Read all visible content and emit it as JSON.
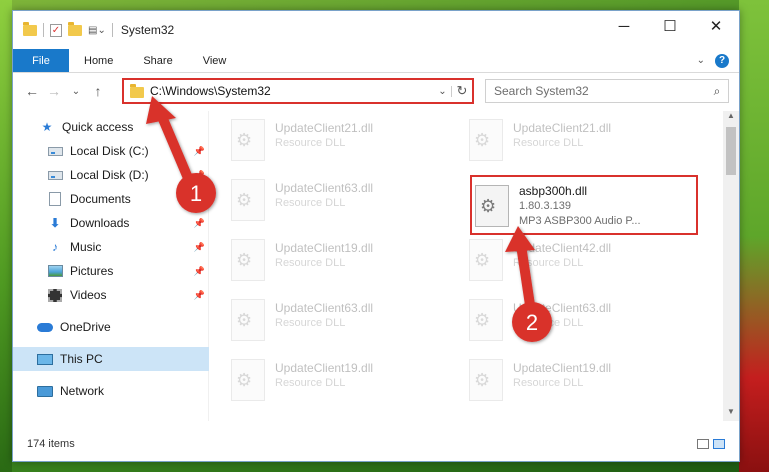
{
  "window": {
    "title": "System32"
  },
  "caption": {
    "minimize": "─",
    "maximize": "☐",
    "close": "✕"
  },
  "ribbon": {
    "tabs": [
      "File",
      "Home",
      "Share",
      "View"
    ],
    "help": "?",
    "expand": "⌄"
  },
  "nav": {
    "back": "←",
    "forward": "→",
    "recent": "⌄",
    "up": "↑"
  },
  "address": {
    "path": "C:\\Windows\\System32",
    "dropdown": "⌄",
    "refresh": "↻"
  },
  "search": {
    "placeholder": "Search System32",
    "icon": "search-icon"
  },
  "sidebar": {
    "items": [
      {
        "label": "Quick access",
        "icon": "star-icon",
        "pinned": false
      },
      {
        "label": "Local Disk (C:)",
        "icon": "drive-icon",
        "pinned": true
      },
      {
        "label": "Local Disk (D:)",
        "icon": "drive-icon",
        "pinned": true
      },
      {
        "label": "Documents",
        "icon": "documents-icon",
        "pinned": true
      },
      {
        "label": "Downloads",
        "icon": "download-icon",
        "pinned": true
      },
      {
        "label": "Music",
        "icon": "music-icon",
        "pinned": true
      },
      {
        "label": "Pictures",
        "icon": "pictures-icon",
        "pinned": true
      },
      {
        "label": "Videos",
        "icon": "videos-icon",
        "pinned": true
      },
      {
        "label": "OneDrive",
        "icon": "cloud-icon",
        "pinned": false
      },
      {
        "label": "This PC",
        "icon": "computer-icon",
        "pinned": false,
        "selected": true
      },
      {
        "label": "Network",
        "icon": "network-icon",
        "pinned": false
      }
    ]
  },
  "files": {
    "left": [
      {
        "name": "UpdateClient21.dll",
        "type": "Resource DLL"
      },
      {
        "name": "UpdateClient63.dll",
        "type": "Resource DLL"
      },
      {
        "name": "UpdateClient19.dll",
        "type": "Resource DLL"
      },
      {
        "name": "UpdateClient63.dll",
        "type": "Resource DLL"
      },
      {
        "name": "UpdateClient19.dll",
        "type": "Resource DLL"
      }
    ],
    "right": [
      {
        "name": "UpdateClient21.dll",
        "type": "Resource DLL"
      },
      {
        "name": "UpdateClient42.dll",
        "type": "Resource DLL"
      },
      {
        "name": "UpdateClient63.dll",
        "type": "Resource DLL"
      },
      {
        "name": "UpdateClient19.dll",
        "type": "Resource DLL"
      }
    ],
    "selected": {
      "name": "asbp300h.dll",
      "version": "1.80.3.139",
      "description": "MP3 ASBP300 Audio P..."
    }
  },
  "status": {
    "count": "174 items"
  },
  "annotations": {
    "step1": "1",
    "step2": "2",
    "color": "#d9312c"
  },
  "colors": {
    "accent": "#1979ca",
    "highlight": "#d9312c",
    "selection": "#cce4f7"
  }
}
